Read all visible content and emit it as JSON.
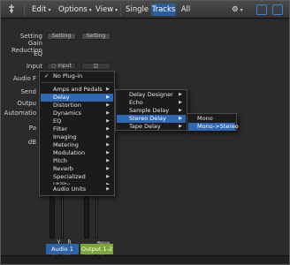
{
  "toolbar": {
    "edit": "Edit",
    "options": "Options",
    "view": "View",
    "tabs": [
      "Single",
      "Tracks",
      "All"
    ],
    "active_tab": "Tracks"
  },
  "rows": {
    "setting": "Setting",
    "gain_reduction": "Gain Reduction",
    "eq": "EQ",
    "input": "Input",
    "audio_fx": "Audio F",
    "sends": "Send",
    "output": "Outpu",
    "automation": "Automatio",
    "pan": "Pa",
    "db": "dB"
  },
  "strip1": {
    "setting": "Setting",
    "input": "Input",
    "r": "R",
    "m": "M",
    "s": "S",
    "name": "Audio 1",
    "color": "#2f63a8"
  },
  "strip2": {
    "setting": "Setting",
    "m": "M",
    "s": "S",
    "bnce": "Bnce",
    "name": "Output 1-2",
    "color": "#7da63a"
  },
  "menu1": {
    "no_plugin": "No Plug-in",
    "items": [
      "Amps and Pedals",
      "Delay",
      "Distortion",
      "Dynamics",
      "EQ",
      "Filter",
      "Imaging",
      "Metering",
      "Modulation",
      "Pitch",
      "Reverb",
      "Specialized",
      "Utility"
    ],
    "highlighted": "Delay",
    "audio_units": "Audio Units"
  },
  "menu2": {
    "items": [
      "Delay Designer",
      "Echo",
      "Sample Delay",
      "Stereo Delay",
      "Tape Delay"
    ],
    "highlighted": "Stereo Delay"
  },
  "menu3": {
    "items": [
      "Mono",
      "Mono->Stereo"
    ],
    "highlighted": "Mono->Stereo"
  }
}
